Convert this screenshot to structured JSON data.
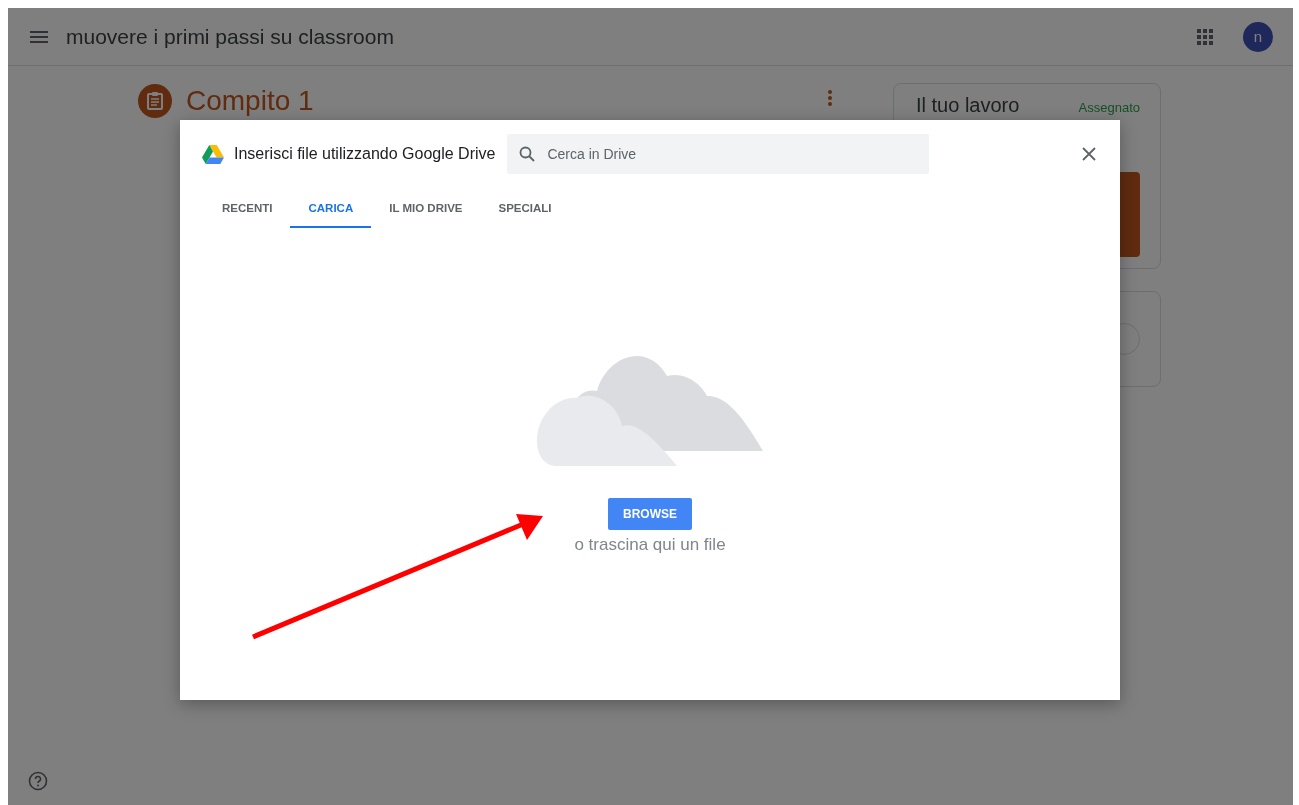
{
  "header": {
    "title": "muovere i primi passi su classroom",
    "avatar_letter": "n"
  },
  "assignment": {
    "title": "Compito 1"
  },
  "work_card": {
    "title": "Il tuo lavoro",
    "status": "Assegnato"
  },
  "dialog": {
    "title": "Inserisci file utilizzando Google Drive",
    "search": {
      "placeholder": "Cerca in Drive"
    },
    "tabs": [
      {
        "label": "RECENTI",
        "selected": false
      },
      {
        "label": "CARICA",
        "selected": true
      },
      {
        "label": "IL MIO DRIVE",
        "selected": false
      },
      {
        "label": "SPECIALI",
        "selected": false
      }
    ],
    "browse_button": "BROWSE",
    "drop_hint": "o trascina qui un file"
  }
}
